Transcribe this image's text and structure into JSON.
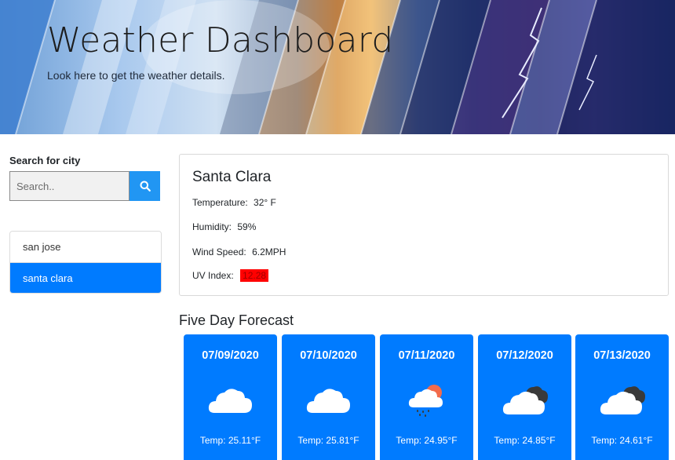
{
  "header": {
    "title": "Weather Dashboard",
    "subtitle": "Look here to get the weather details."
  },
  "sidebar": {
    "search_label": "Search for city",
    "search_placeholder": "Search..",
    "search_value": "",
    "search_button_icon": "search-icon",
    "history": [
      {
        "label": "san jose",
        "active": false
      },
      {
        "label": "santa clara",
        "active": true
      }
    ]
  },
  "current": {
    "city": "Santa Clara",
    "temperature_label": "Temperature:",
    "temperature_value": "32° F",
    "humidity_label": "Humidity:",
    "humidity_value": "59%",
    "wind_label": "Wind Speed:",
    "wind_value": "6.2MPH",
    "uv_label": "UV Index:",
    "uv_value": "12.28",
    "uv_color": "#ff0000"
  },
  "forecast": {
    "title": "Five Day Forecast",
    "card_color": "#007bff",
    "days": [
      {
        "date": "07/09/2020",
        "icon": "cloud-icon",
        "temp": "Temp: 25.11°F"
      },
      {
        "date": "07/10/2020",
        "icon": "cloud-icon",
        "temp": "Temp: 25.81°F"
      },
      {
        "date": "07/11/2020",
        "icon": "sun-rain-cloud-icon",
        "temp": "Temp: 24.95°F"
      },
      {
        "date": "07/12/2020",
        "icon": "dark-clouds-icon",
        "temp": "Temp: 24.85°F"
      },
      {
        "date": "07/13/2020",
        "icon": "dark-clouds-icon",
        "temp": "Temp: 24.61°F"
      }
    ]
  },
  "colors": {
    "accent": "#007bff",
    "search_button": "#2196f3"
  }
}
